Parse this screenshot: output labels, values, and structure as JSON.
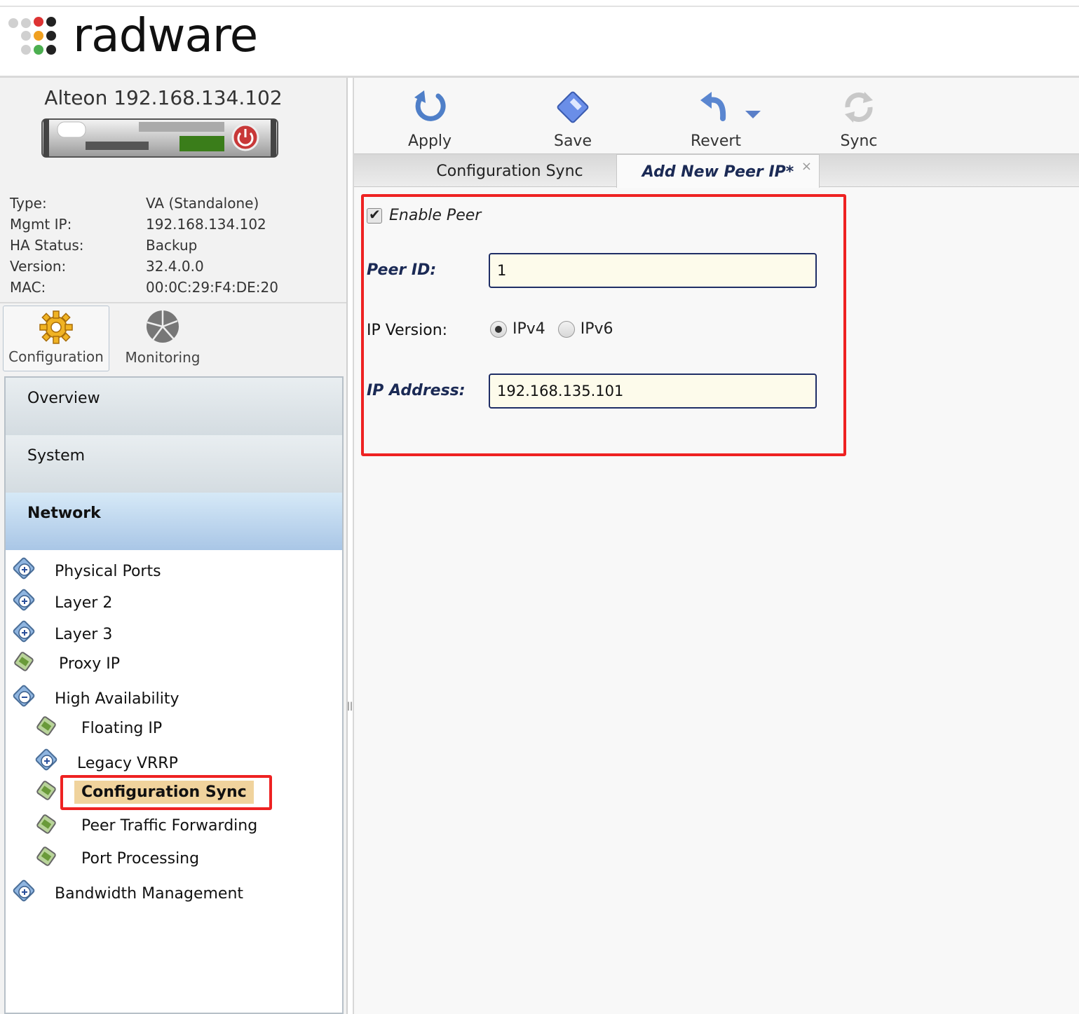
{
  "brand": {
    "logo_text": "radware"
  },
  "device": {
    "title": "Alteon 192.168.134.102",
    "info": [
      {
        "label": "Type:",
        "value": "VA (Standalone)"
      },
      {
        "label": "Mgmt IP:",
        "value": "192.168.134.102"
      },
      {
        "label": "HA Status:",
        "value": "Backup"
      },
      {
        "label": "Version:",
        "value": "32.4.0.0"
      },
      {
        "label": "MAC:",
        "value": "00:0C:29:F4:DE:20"
      }
    ]
  },
  "modes": [
    {
      "label": "Configuration",
      "icon": "gear-icon",
      "active": true
    },
    {
      "label": "Monitoring",
      "icon": "monitoring-icon",
      "active": false
    }
  ],
  "nav": {
    "sections": [
      "Overview",
      "System",
      "Network"
    ],
    "active_section": "Network",
    "tree": [
      {
        "label": "Physical Ports",
        "icon": "expand-icon"
      },
      {
        "label": "Layer 2",
        "icon": "expand-icon"
      },
      {
        "label": "Layer 3",
        "icon": "expand-icon"
      },
      {
        "label": "Proxy IP",
        "icon": "leaf-icon"
      },
      {
        "label": "High Availability",
        "icon": "collapse-icon"
      },
      {
        "label": "Floating IP",
        "icon": "leaf-icon"
      },
      {
        "label": "Legacy VRRP",
        "icon": "expand-icon"
      },
      {
        "label": "Configuration Sync",
        "icon": "leaf-icon",
        "selected": true
      },
      {
        "label": "Peer Traffic Forwarding",
        "icon": "leaf-icon"
      },
      {
        "label": "Port Processing",
        "icon": "leaf-icon"
      },
      {
        "label": "Bandwidth Management",
        "icon": "expand-icon"
      }
    ]
  },
  "toolbar": {
    "apply": "Apply",
    "save": "Save",
    "revert": "Revert",
    "sync": "Sync"
  },
  "tabs": [
    {
      "label": "Configuration Sync",
      "active": false
    },
    {
      "label": "Add New Peer IP*",
      "active": true,
      "close": "×"
    }
  ],
  "form": {
    "enable_peer_label": "Enable Peer",
    "enable_peer_checked": true,
    "peer_id_label": "Peer ID:",
    "peer_id_value": "1",
    "ip_version_label": "IP Version:",
    "ip_version_options": [
      "IPv4",
      "IPv6"
    ],
    "ip_version_selected": "IPv4",
    "ip_address_label": "IP Address:",
    "ip_address_value": "192.168.135.101"
  },
  "colors": {
    "highlight_box": "#ee2222",
    "selected_item": "#f0d39d",
    "input_bg": "#fdfbeb",
    "input_border": "#1f2e66"
  }
}
